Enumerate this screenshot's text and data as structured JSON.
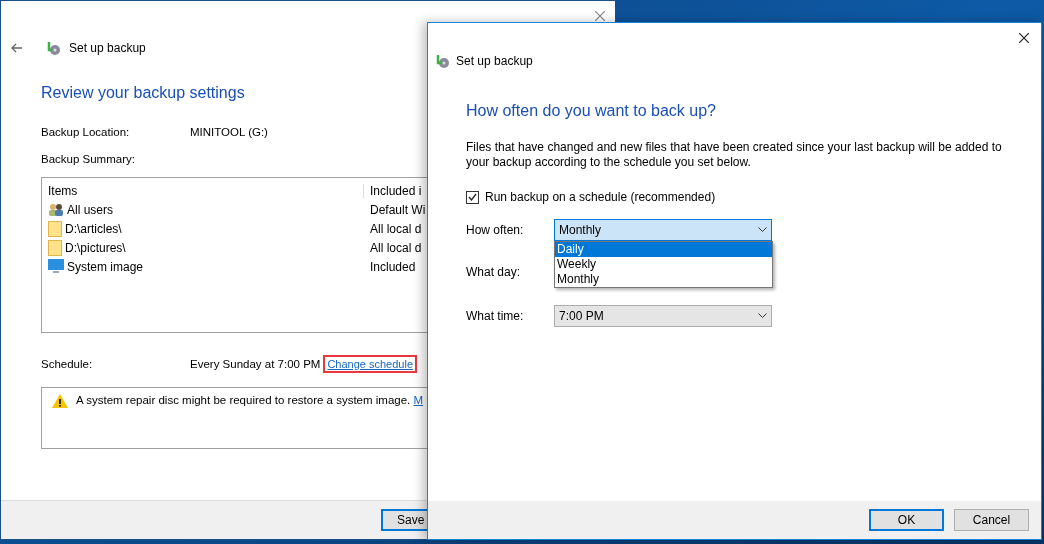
{
  "back_window": {
    "title": "Set up backup",
    "heading": "Review your backup settings",
    "location_label": "Backup Location:",
    "location_value": "MINITOOL (G:)",
    "summary_label": "Backup Summary:",
    "table": {
      "columns": [
        "Items",
        "Included i"
      ],
      "rows": [
        {
          "kind": "users",
          "name": "All users",
          "included": "Default Wi"
        },
        {
          "kind": "folder",
          "name": "D:\\articles\\",
          "included": "All local d"
        },
        {
          "kind": "folder",
          "name": "D:\\pictures\\",
          "included": "All local d"
        },
        {
          "kind": "system",
          "name": "System image",
          "included": "Included"
        }
      ]
    },
    "schedule_label": "Schedule:",
    "schedule_value": "Every Sunday at 7:00 PM",
    "change_link": "Change schedule",
    "warning": "A system repair disc might be required to restore a system image.",
    "warning_link": "M",
    "save_button": "Save"
  },
  "dialog": {
    "title": "Set up backup",
    "heading": "How often do you want to back up?",
    "description": "Files that have changed and new files that have been created since your last backup will be added to your backup according to the schedule you set below.",
    "schedule_checkbox": {
      "label": "Run backup on a schedule (recommended)",
      "checked": true
    },
    "how_often": {
      "label": "How often:",
      "value": "Monthly",
      "expanded": true,
      "options": [
        {
          "label": "Daily",
          "highlighted": true
        },
        {
          "label": "Weekly",
          "highlighted": false
        },
        {
          "label": "Monthly",
          "highlighted": false
        }
      ]
    },
    "what_day": {
      "label": "What day:"
    },
    "what_time": {
      "label": "What time:",
      "value": "7:00 PM"
    },
    "buttons": [
      "OK",
      "Cancel"
    ]
  }
}
